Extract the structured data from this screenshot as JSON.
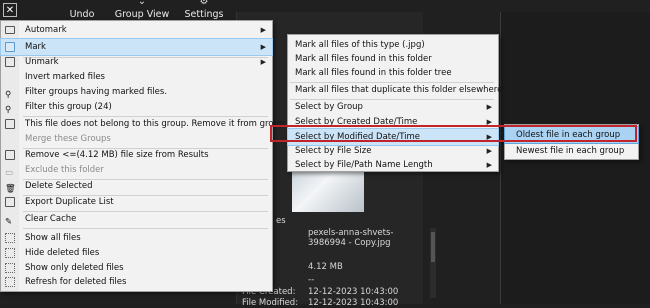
{
  "toolbar": {
    "undo_label": "Undo",
    "group_view_label": "Group View",
    "settings_label": "Settings"
  },
  "details": {
    "section_header": "es",
    "filename": "pexels-anna-shvets-3986994 - Copy.jpg",
    "size": "4.12 MB",
    "dash": "--",
    "file_created_label": "File Created:",
    "file_created_value": "12-12-2023 10:43:00",
    "file_modified_label": "File Modified:",
    "file_modified_value": "12-12-2023 10:43:00"
  },
  "menu_main": {
    "items": [
      {
        "label": "Automark",
        "icon": "monitor-icon",
        "submenu": true
      },
      {
        "label": "Mark",
        "icon": "checkbox-icon",
        "submenu": true,
        "highlighted": true
      },
      {
        "label": "Unmark",
        "icon": "unmark-icon",
        "submenu": true
      },
      {
        "label": "Invert marked files"
      },
      {
        "label": "Filter groups having marked files."
      },
      {
        "label": "Filter this group (24)"
      },
      {
        "label": "This file does not belong to this group. Remove it from group.",
        "icon": "info-icon"
      },
      {
        "label": "Merge these Groups",
        "disabled": true
      },
      {
        "label": "Remove <=(4.12 MB) file size from Results",
        "icon": "size-icon"
      },
      {
        "label": "Exclude this folder",
        "disabled": true
      },
      {
        "label": "Delete Selected",
        "icon": "delete-icon"
      },
      {
        "label": "Export Duplicate List",
        "icon": "export-icon"
      },
      {
        "label": "Clear Cache",
        "icon": "cache-icon"
      },
      {
        "label": "Show all files",
        "icon": "eye-icon"
      },
      {
        "label": "Hide deleted files",
        "icon": "eye-icon"
      },
      {
        "label": "Show only deleted files",
        "icon": "eye-icon"
      },
      {
        "label": "Refresh for deleted files",
        "icon": "refresh-icon"
      }
    ]
  },
  "menu_mark": {
    "items": [
      {
        "label": "Mark all files of this type (.jpg)"
      },
      {
        "label": "Mark all files found in this folder"
      },
      {
        "label": "Mark all files found in this folder tree"
      },
      {
        "label": "Mark all files that duplicate this folder elsewhere"
      },
      {
        "label": "Select by Group",
        "submenu": true
      },
      {
        "label": "Select by Created Date/Time",
        "submenu": true
      },
      {
        "label": "Select by Modified Date/Time",
        "submenu": true,
        "highlighted": true
      },
      {
        "label": "Select by File Size",
        "submenu": true
      },
      {
        "label": "Select by File/Path Name Length",
        "submenu": true
      }
    ]
  },
  "menu_modified": {
    "items": [
      {
        "label": "Oldest file in each group",
        "highlighted": true
      },
      {
        "label": "Newest file in each group"
      }
    ]
  },
  "colors": {
    "highlight": "#cce4f7",
    "submenu_highlight": "#a9d2f3",
    "callout_box": "#c0252b"
  }
}
